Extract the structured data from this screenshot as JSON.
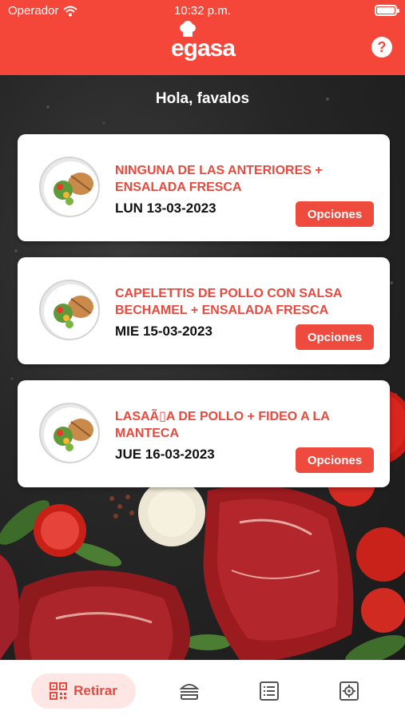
{
  "status_bar": {
    "carrier": "Operador",
    "time": "10:32 p.m."
  },
  "header": {
    "logo": "egasa",
    "help_icon": "question-circle-icon",
    "accent": "#f4473a"
  },
  "greeting": "Hola, favalos",
  "orders": [
    {
      "title": "NINGUNA DE LAS ANTERIORES + ENSALADA FRESCA",
      "date": "LUN 13-03-2023",
      "button": "Opciones"
    },
    {
      "title": "CAPELETTIS DE POLLO CON SALSA BECHAMEL + ENSALADA FRESCA",
      "date": "MIE 15-03-2023",
      "button": "Opciones"
    },
    {
      "title": "LASAÃ▯A DE POLLO + FIDEO A LA MANTECA",
      "date": "JUE 16-03-2023",
      "button": "Opciones"
    }
  ],
  "tabbar": {
    "active_label": "Retirar",
    "tabs": [
      "qr-code-icon",
      "burger-icon",
      "list-icon",
      "settings-icon"
    ]
  }
}
